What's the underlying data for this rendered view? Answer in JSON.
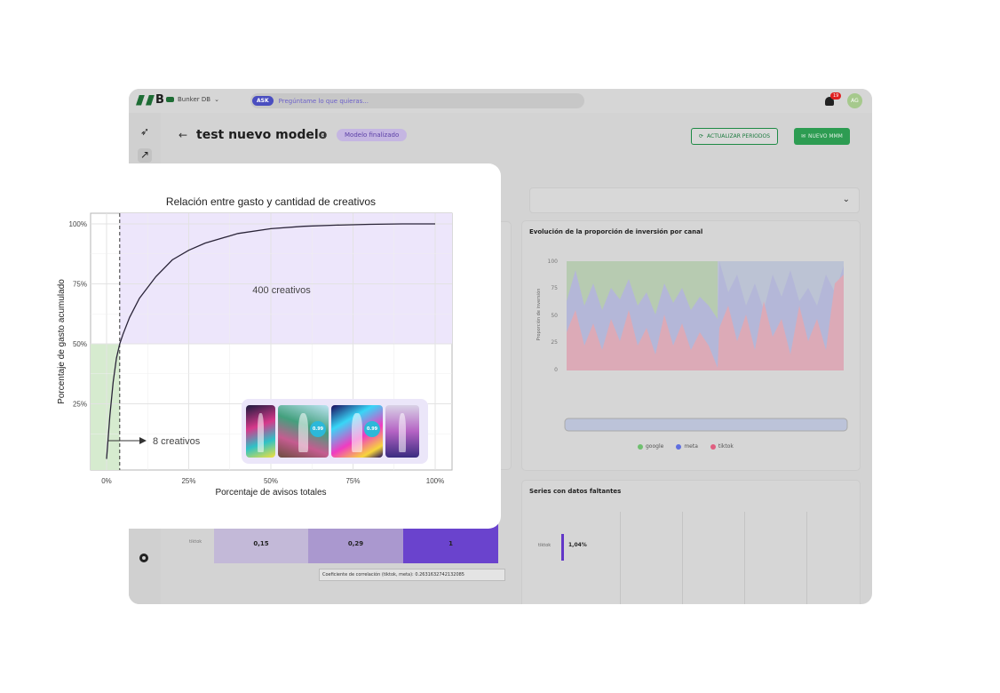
{
  "topbar": {
    "logo_text": "B",
    "workspace_name": "Bunker DB",
    "ask_badge": "ASK",
    "ask_placeholder": "Pregúntame lo que quieras...",
    "notification_count": "19",
    "avatar_initials": "AG"
  },
  "header": {
    "title": "test nuevo modelo",
    "status": "Modelo finalizado",
    "btn_refresh": "ACTUALIZAR PERIODOS",
    "btn_new": "NUEVO MMM"
  },
  "evolution_card": {
    "title": "Evolución de la proporción de inversión por canal",
    "ylabel": "Proporción de inversión",
    "yticks": [
      "100",
      "75",
      "50",
      "25",
      "0"
    ],
    "legend": [
      {
        "name": "google",
        "color": "#6fbf6f"
      },
      {
        "name": "meta",
        "color": "#5f6fe0"
      },
      {
        "name": "tiktok",
        "color": "#e05f80"
      }
    ]
  },
  "series_card": {
    "title": "Series con datos faltantes",
    "row_label": "tiktok",
    "row_value": "1,04%"
  },
  "heatmap": {
    "row_label": "tiktok",
    "cells": [
      "0,15",
      "0,29",
      "1"
    ],
    "tooltip": "Coeficiente de correlación  (tiktok, meta): 0.2631632742132085"
  },
  "overlay_chart": {
    "chart_data": {
      "type": "line",
      "title": "Relación entre gasto y cantidad de creativos",
      "xlabel": "Porcentaje de avisos totales",
      "ylabel": "Porcentaje de gasto acumulado",
      "xticks": [
        "0%",
        "25%",
        "50%",
        "75%",
        "100%"
      ],
      "yticks": [
        "25%",
        "50%",
        "75%",
        "100%"
      ],
      "xlim": [
        0,
        100
      ],
      "ylim": [
        0,
        100
      ],
      "grid": true,
      "x": [
        0,
        1,
        2,
        3,
        4,
        5,
        7,
        10,
        15,
        20,
        25,
        30,
        40,
        50,
        60,
        70,
        80,
        90,
        100
      ],
      "y": [
        2,
        20,
        34,
        44,
        50,
        54,
        61,
        69,
        78,
        85,
        89,
        92,
        96,
        98,
        99,
        99.5,
        99.8,
        100,
        100
      ],
      "threshold_x": 4,
      "annotations": [
        "400 creativos",
        "8 creativos"
      ]
    }
  }
}
